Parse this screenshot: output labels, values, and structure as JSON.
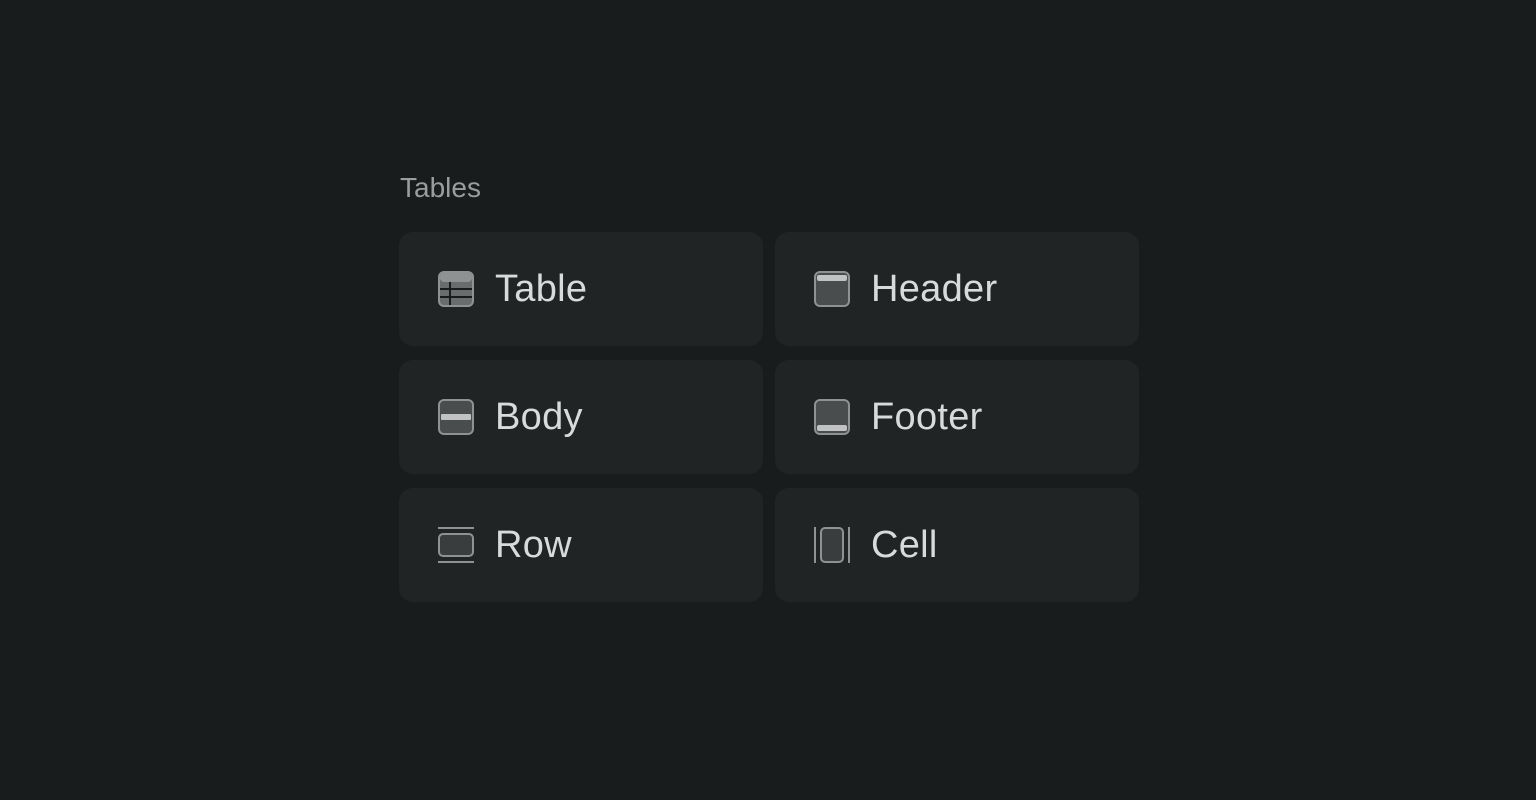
{
  "section": {
    "title": "Tables"
  },
  "items": [
    {
      "label": "Table",
      "icon": "table-icon"
    },
    {
      "label": "Header",
      "icon": "table-header-icon"
    },
    {
      "label": "Body",
      "icon": "table-body-icon"
    },
    {
      "label": "Footer",
      "icon": "table-footer-icon"
    },
    {
      "label": "Row",
      "icon": "table-row-icon"
    },
    {
      "label": "Cell",
      "icon": "table-cell-icon"
    }
  ],
  "colors": {
    "background": "#181c1d",
    "tile": "#202425",
    "label": "#d8dadb",
    "section_title": "#9a9d9e",
    "icon": "#8f9293"
  }
}
